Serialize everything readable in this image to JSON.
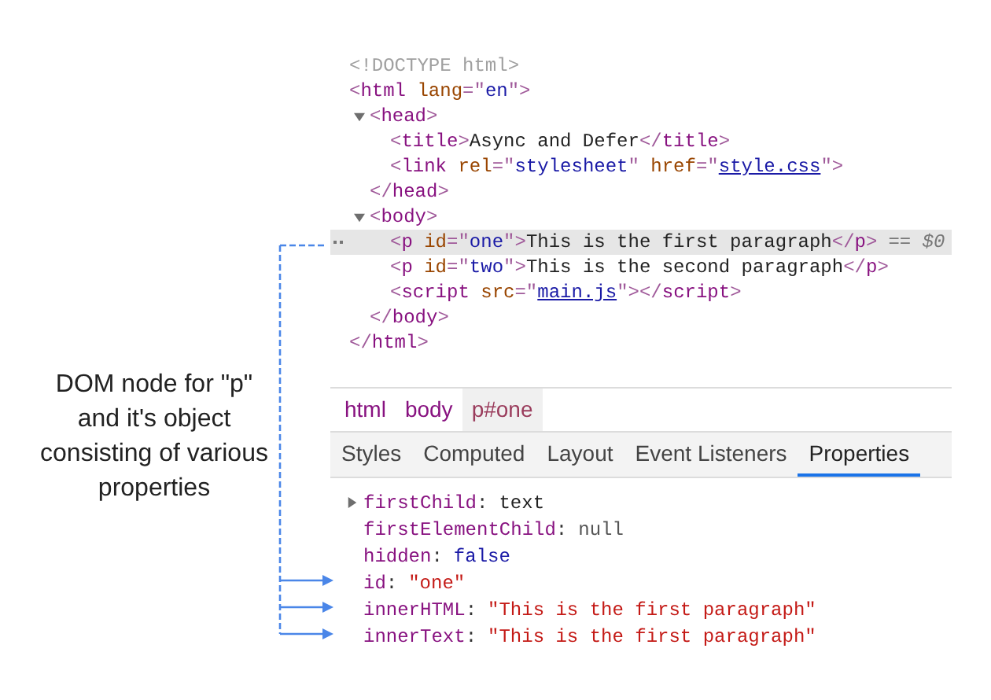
{
  "annotation": {
    "text": "DOM node for \"p\" and it's object consisting of various properties"
  },
  "elements_tree": [
    {
      "kind": "plain",
      "selected": false,
      "tokens": [
        {
          "kind": "doctype",
          "text": "<!DOCTYPE html>"
        }
      ]
    },
    {
      "kind": "plain",
      "selected": false,
      "tokens": [
        {
          "kind": "punct",
          "text": "<"
        },
        {
          "kind": "tag",
          "text": "html"
        },
        {
          "kind": "attr",
          "text": " lang"
        },
        {
          "kind": "punct",
          "text": "=\""
        },
        {
          "kind": "value",
          "text": "en"
        },
        {
          "kind": "punct",
          "text": "\">"
        }
      ],
      "close_tokens": [
        {
          "kind": "punct",
          "text": "</"
        },
        {
          "kind": "tag",
          "text": "html"
        },
        {
          "kind": "punct",
          "text": ">"
        }
      ],
      "children": [
        {
          "kind": "expandable",
          "expanded": true,
          "selected": false,
          "tokens": [
            {
              "kind": "punct",
              "text": "<"
            },
            {
              "kind": "tag",
              "text": "head"
            },
            {
              "kind": "punct",
              "text": ">"
            }
          ],
          "close_tokens": [
            {
              "kind": "punct",
              "text": "</"
            },
            {
              "kind": "tag",
              "text": "head"
            },
            {
              "kind": "punct",
              "text": ">"
            }
          ],
          "children": [
            {
              "kind": "plain",
              "selected": false,
              "tokens": [
                {
                  "kind": "punct",
                  "text": "<"
                },
                {
                  "kind": "tag",
                  "text": "title"
                },
                {
                  "kind": "punct",
                  "text": ">"
                },
                {
                  "kind": "text",
                  "text": "Async and Defer"
                },
                {
                  "kind": "punct",
                  "text": "</"
                },
                {
                  "kind": "tag",
                  "text": "title"
                },
                {
                  "kind": "punct",
                  "text": ">"
                }
              ]
            },
            {
              "kind": "plain",
              "selected": false,
              "tokens": [
                {
                  "kind": "punct",
                  "text": "<"
                },
                {
                  "kind": "tag",
                  "text": "link"
                },
                {
                  "kind": "attr",
                  "text": " rel"
                },
                {
                  "kind": "punct",
                  "text": "=\""
                },
                {
                  "kind": "value",
                  "text": "stylesheet"
                },
                {
                  "kind": "punct",
                  "text": "\""
                },
                {
                  "kind": "attr",
                  "text": " href"
                },
                {
                  "kind": "punct",
                  "text": "=\""
                },
                {
                  "kind": "link",
                  "text": "style.css"
                },
                {
                  "kind": "punct",
                  "text": "\">"
                }
              ]
            }
          ]
        },
        {
          "kind": "expandable",
          "expanded": true,
          "selected": false,
          "tokens": [
            {
              "kind": "punct",
              "text": "<"
            },
            {
              "kind": "tag",
              "text": "body"
            },
            {
              "kind": "punct",
              "text": ">"
            }
          ],
          "close_tokens": [
            {
              "kind": "punct",
              "text": "</"
            },
            {
              "kind": "tag",
              "text": "body"
            },
            {
              "kind": "punct",
              "text": ">"
            }
          ],
          "children": [
            {
              "kind": "plain",
              "selected": true,
              "marker": "== $0",
              "tokens": [
                {
                  "kind": "punct",
                  "text": "<"
                },
                {
                  "kind": "tag",
                  "text": "p"
                },
                {
                  "kind": "attr",
                  "text": " id"
                },
                {
                  "kind": "punct",
                  "text": "=\""
                },
                {
                  "kind": "value",
                  "text": "one"
                },
                {
                  "kind": "punct",
                  "text": "\">"
                },
                {
                  "kind": "text",
                  "text": "This is the first paragraph"
                },
                {
                  "kind": "punct",
                  "text": "</"
                },
                {
                  "kind": "tag",
                  "text": "p"
                },
                {
                  "kind": "punct",
                  "text": ">"
                }
              ]
            },
            {
              "kind": "plain",
              "selected": false,
              "tokens": [
                {
                  "kind": "punct",
                  "text": "<"
                },
                {
                  "kind": "tag",
                  "text": "p"
                },
                {
                  "kind": "attr",
                  "text": " id"
                },
                {
                  "kind": "punct",
                  "text": "=\""
                },
                {
                  "kind": "value",
                  "text": "two"
                },
                {
                  "kind": "punct",
                  "text": "\">"
                },
                {
                  "kind": "text",
                  "text": "This is the second paragraph"
                },
                {
                  "kind": "punct",
                  "text": "</"
                },
                {
                  "kind": "tag",
                  "text": "p"
                },
                {
                  "kind": "punct",
                  "text": ">"
                }
              ]
            },
            {
              "kind": "plain",
              "selected": false,
              "tokens": [
                {
                  "kind": "punct",
                  "text": "<"
                },
                {
                  "kind": "tag",
                  "text": "script"
                },
                {
                  "kind": "attr",
                  "text": " src"
                },
                {
                  "kind": "punct",
                  "text": "=\""
                },
                {
                  "kind": "link",
                  "text": "main.js"
                },
                {
                  "kind": "punct",
                  "text": "\"></"
                },
                {
                  "kind": "tag",
                  "text": "script"
                },
                {
                  "kind": "punct",
                  "text": ">"
                }
              ]
            }
          ]
        }
      ]
    }
  ],
  "breadcrumbs": [
    {
      "label": "html",
      "selected": false
    },
    {
      "label": "body",
      "selected": false
    },
    {
      "label": "p#one",
      "selected": true
    }
  ],
  "tabs": [
    {
      "label": "Styles",
      "selected": false
    },
    {
      "label": "Computed",
      "selected": false
    },
    {
      "label": "Layout",
      "selected": false
    },
    {
      "label": "Event Listeners",
      "selected": false
    },
    {
      "label": "Properties",
      "selected": true
    }
  ],
  "properties": [
    {
      "name": "firstChild",
      "colon": ":",
      "value": "text",
      "kind": "object",
      "expandable": true,
      "pointed": false
    },
    {
      "name": "firstElementChild",
      "colon": ":",
      "value": "null",
      "kind": "null",
      "expandable": false,
      "pointed": false
    },
    {
      "name": "hidden",
      "colon": ":",
      "value": "false",
      "kind": "keyword",
      "expandable": false,
      "pointed": false
    },
    {
      "name": "id",
      "colon": ":",
      "value": "\"one\"",
      "kind": "string",
      "expandable": false,
      "pointed": true
    },
    {
      "name": "innerHTML",
      "colon": ":",
      "value": "\"This is the first paragraph\"",
      "kind": "string",
      "expandable": false,
      "pointed": true
    },
    {
      "name": "innerText",
      "colon": ":",
      "value": "\"This is the first paragraph\"",
      "kind": "string",
      "expandable": false,
      "pointed": true
    }
  ]
}
